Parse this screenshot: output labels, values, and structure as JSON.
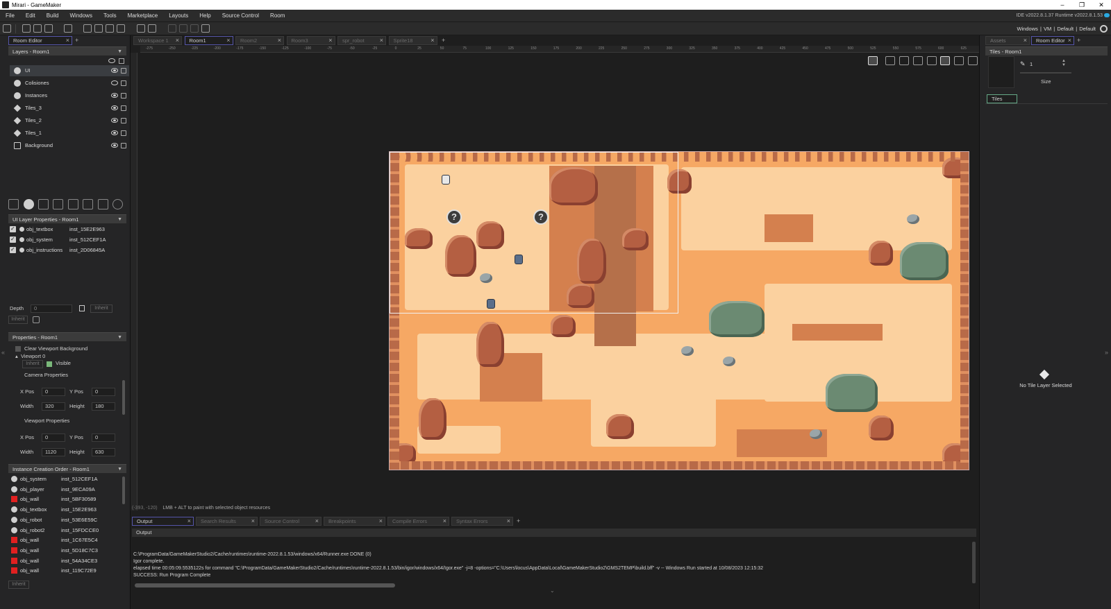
{
  "window": {
    "title": "Mirari - GameMaker",
    "controls": [
      "–",
      "❐",
      "✕"
    ]
  },
  "menu": [
    "File",
    "Edit",
    "Build",
    "Windows",
    "Tools",
    "Marketplace",
    "Layouts",
    "Help",
    "Source Control",
    "Room"
  ],
  "version": "IDE v2022.8.1.37  Runtime v2022.8.1.53",
  "target": "Windows | VM | Default | Default",
  "left_panel": {
    "tab": "Room Editor",
    "layers_header": "Layers - Room1",
    "layers": [
      {
        "name": "UI",
        "icon": "instance-layer-icon",
        "visible": true
      },
      {
        "name": "Colisiones",
        "icon": "instance-layer-icon",
        "visible": false
      },
      {
        "name": "Instances",
        "icon": "instance-layer-icon",
        "visible": true
      },
      {
        "name": "Tiles_3",
        "icon": "tile-layer-icon",
        "visible": true
      },
      {
        "name": "Tiles_2",
        "icon": "tile-layer-icon",
        "visible": true
      },
      {
        "name": "Tiles_1",
        "icon": "tile-layer-icon",
        "visible": true
      },
      {
        "name": "Background",
        "icon": "background-layer-icon",
        "visible": true
      }
    ],
    "ui_layer_header": "UI Layer Properties - Room1",
    "ui_instances": [
      {
        "object": "obj_textbox",
        "instance": "inst_15E2E963"
      },
      {
        "object": "obj_system",
        "instance": "inst_512CEF1A"
      },
      {
        "object": "obj_instructions",
        "instance": "inst_2D06845A"
      }
    ],
    "depth_label": "Depth",
    "depth_value": "0",
    "inherit": "Inherit",
    "properties_header": "Properties - Room1",
    "clear_viewport": "Clear Viewport Background",
    "viewport0": "Viewport 0",
    "visible_label": "Visible",
    "camera_props": "Camera Properties",
    "viewport_props": "Viewport Properties",
    "xpos_label": "X Pos",
    "ypos_label": "Y Pos",
    "width_label": "Width",
    "height_label": "Height",
    "camera": {
      "x": "0",
      "y": "0",
      "w": "320",
      "h": "180"
    },
    "viewport": {
      "x": "0",
      "y": "0",
      "w": "1120",
      "h": "630"
    },
    "creation_header": "Instance Creation Order - Room1",
    "creation_order": [
      {
        "object": "obj_system",
        "instance": "inst_512CEF1A",
        "icon": "circle"
      },
      {
        "object": "obj_player",
        "instance": "inst_9ECA09A",
        "icon": "circle"
      },
      {
        "object": "obj_wall",
        "instance": "inst_5BF30589",
        "icon": "red"
      },
      {
        "object": "obj_textbox",
        "instance": "inst_15E2E963",
        "icon": "circle"
      },
      {
        "object": "obj_robot",
        "instance": "inst_53E6E59C",
        "icon": "circle"
      },
      {
        "object": "obj_robot2",
        "instance": "inst_15FDCCE0",
        "icon": "circle"
      },
      {
        "object": "obj_wall",
        "instance": "inst_1C67E5C4",
        "icon": "red"
      },
      {
        "object": "obj_wall",
        "instance": "inst_5D18C7C3",
        "icon": "red"
      },
      {
        "object": "obj_wall",
        "instance": "inst_54A34CE3",
        "icon": "red"
      },
      {
        "object": "obj_wall",
        "instance": "inst_119C72E9",
        "icon": "red"
      }
    ],
    "bottom_inherit": "Inherit"
  },
  "doc_tabs": [
    {
      "label": "Workspace 1",
      "active": false
    },
    {
      "label": "Room1",
      "active": true
    },
    {
      "label": "Room2",
      "active": false
    },
    {
      "label": "Room3",
      "active": false
    },
    {
      "label": "spr_robot",
      "active": false
    },
    {
      "label": "Sprite18",
      "active": false
    }
  ],
  "ruler_ticks": [
    "-275",
    "-250",
    "-225",
    "-200",
    "-175",
    "-150",
    "-125",
    "-100",
    "-75",
    "-50",
    "-25",
    "0",
    "25",
    "50",
    "75",
    "100",
    "125",
    "150",
    "175",
    "200",
    "225",
    "250",
    "275",
    "300",
    "325",
    "350",
    "375",
    "400",
    "425",
    "450",
    "475",
    "500",
    "525",
    "550",
    "575",
    "600",
    "625"
  ],
  "status": {
    "coords": "(-393, -120)",
    "hint": "LMB + ALT to paint with selected object resources"
  },
  "output_tabs": [
    "Output",
    "Search Results",
    "Source Control",
    "Breakpoints",
    "Compile Errors",
    "Syntax Errors"
  ],
  "output_header": "Output",
  "output_lines": [
    "C:\\ProgramData/GameMakerStudio2/Cache/runtimes\\runtime-2022.8.1.53/windows/x64/Runner.exe DONE (0)",
    "Igor complete.",
    "elapsed time 00:05:09.5535122s for command \"C:\\ProgramData/GameMakerStudio2/Cache/runtimes\\runtime-2022.8.1.53/bin/igor/windows/x64/Igor.exe\" -j=8 -options=\"C:\\Users\\locus\\AppData\\Local\\GameMakerStudio2\\GMS2TEMP\\build.bff\" -v -- Windows Run started at 10/08/2023 12:15:32",
    "SUCCESS: Run Program Complete"
  ],
  "right_panel": {
    "tabs": [
      "Assets",
      "Room Editor"
    ],
    "header": "Tiles - Room1",
    "brush_value": "1",
    "size_label": "Size",
    "tiles_tab": "Tiles",
    "no_layer": "No Tile Layer Selected"
  },
  "colors": {
    "sand": "#f6a864",
    "path": "#fbd19f",
    "rock": "#b45f42",
    "bush": "#6b8a72",
    "wall_icon": "#e02020"
  }
}
